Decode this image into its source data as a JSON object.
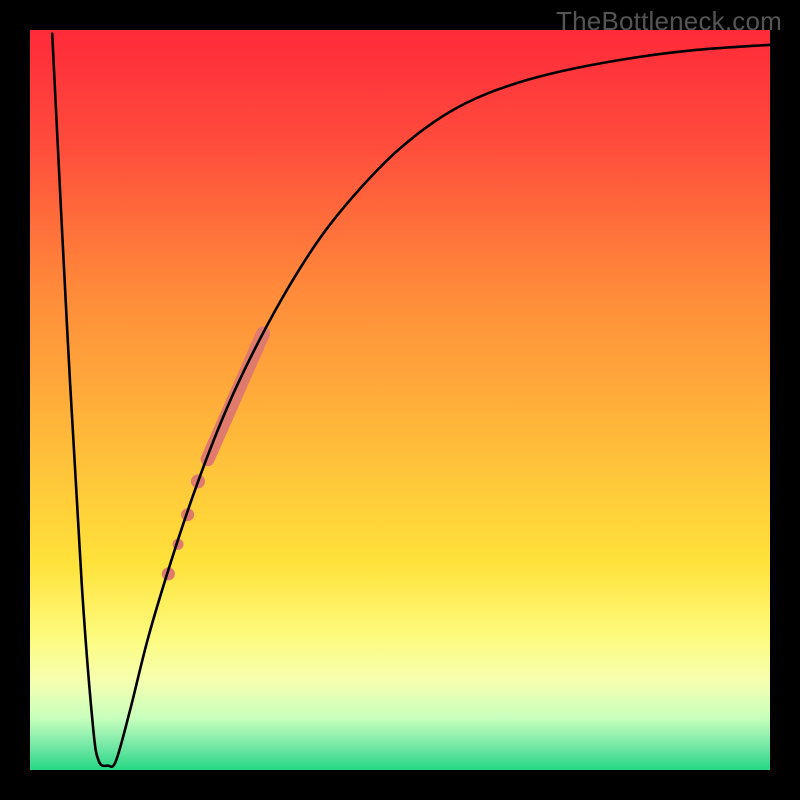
{
  "meta": {
    "source_label": "TheBottleneck.com"
  },
  "chart_data": {
    "type": "line",
    "title": "",
    "xlabel": "",
    "ylabel": "",
    "xlim": [
      0,
      100
    ],
    "ylim": [
      0,
      100
    ],
    "background_gradient": {
      "stops": [
        {
          "offset": 0.0,
          "color": "#ff2a3a"
        },
        {
          "offset": 0.15,
          "color": "#ff4b3c"
        },
        {
          "offset": 0.35,
          "color": "#ff8a3a"
        },
        {
          "offset": 0.55,
          "color": "#ffb93a"
        },
        {
          "offset": 0.72,
          "color": "#ffe23a"
        },
        {
          "offset": 0.82,
          "color": "#fdfb7e"
        },
        {
          "offset": 0.88,
          "color": "#f6ffb0"
        },
        {
          "offset": 0.93,
          "color": "#c8ffbd"
        },
        {
          "offset": 0.97,
          "color": "#6fe6a4"
        },
        {
          "offset": 1.0,
          "color": "#25d884"
        }
      ]
    },
    "curve": {
      "color": "#000000",
      "width": 2.6,
      "points": [
        {
          "x": 3.0,
          "y": 99.5
        },
        {
          "x": 5.0,
          "y": 60.0
        },
        {
          "x": 7.0,
          "y": 25.0
        },
        {
          "x": 8.5,
          "y": 6.0
        },
        {
          "x": 9.3,
          "y": 1.2
        },
        {
          "x": 10.5,
          "y": 0.6
        },
        {
          "x": 11.6,
          "y": 1.2
        },
        {
          "x": 13.5,
          "y": 8.0
        },
        {
          "x": 16.0,
          "y": 18.0
        },
        {
          "x": 19.0,
          "y": 28.0
        },
        {
          "x": 22.0,
          "y": 37.0
        },
        {
          "x": 25.0,
          "y": 45.0
        },
        {
          "x": 28.0,
          "y": 52.0
        },
        {
          "x": 32.0,
          "y": 60.0
        },
        {
          "x": 36.0,
          "y": 67.0
        },
        {
          "x": 40.0,
          "y": 73.0
        },
        {
          "x": 45.0,
          "y": 79.0
        },
        {
          "x": 50.0,
          "y": 84.0
        },
        {
          "x": 56.0,
          "y": 88.5
        },
        {
          "x": 62.0,
          "y": 91.5
        },
        {
          "x": 70.0,
          "y": 94.0
        },
        {
          "x": 80.0,
          "y": 96.0
        },
        {
          "x": 90.0,
          "y": 97.3
        },
        {
          "x": 100.0,
          "y": 98.0
        }
      ]
    },
    "markers": {
      "color": "#e07a6d",
      "items": [
        {
          "type": "segment",
          "x1": 24.0,
          "y1": 42.0,
          "x2": 31.5,
          "y2": 59.0,
          "width": 14
        },
        {
          "type": "dot",
          "x": 22.7,
          "y": 39.0,
          "r": 7
        },
        {
          "type": "dot",
          "x": 21.3,
          "y": 34.5,
          "r": 6.5
        },
        {
          "type": "dot",
          "x": 20.0,
          "y": 30.5,
          "r": 5.5
        },
        {
          "type": "dot",
          "x": 18.7,
          "y": 26.5,
          "r": 6.5
        }
      ]
    }
  }
}
